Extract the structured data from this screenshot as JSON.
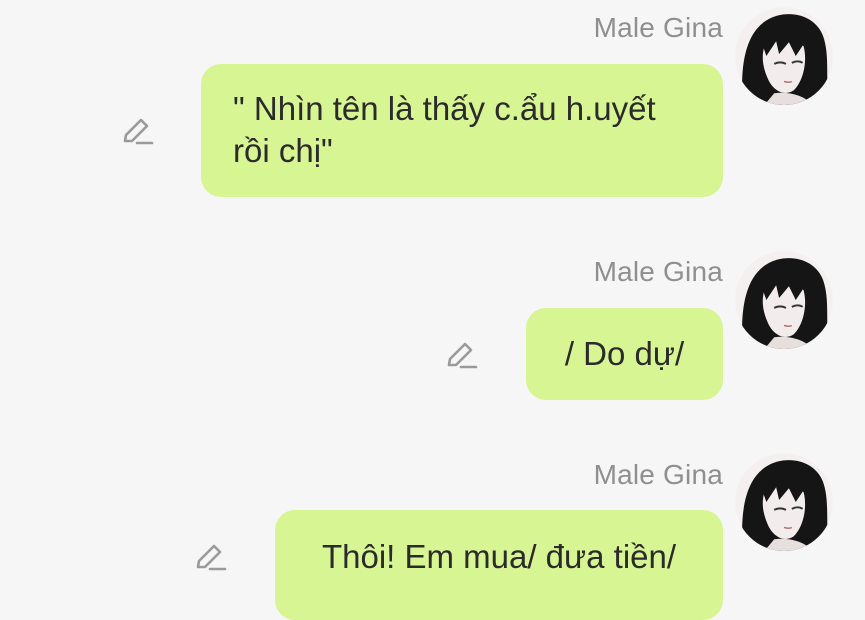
{
  "colors": {
    "background": "#f6f6f6",
    "bubble": "#d8f594",
    "sender_name": "#8f8f8f",
    "message_text": "#2b2b2b",
    "edit_icon": "#9a9a9a"
  },
  "messages": [
    {
      "sender": "Male Gina",
      "text": "\" Nhìn tên là thấy c.ẩu h.uyết rồi chị\"",
      "action_icon": "pencil-edit-icon"
    },
    {
      "sender": "Male Gina",
      "text": "/ Do dự/",
      "action_icon": "pencil-edit-icon"
    },
    {
      "sender": "Male Gina",
      "text": "Thôi! Em mua/ đưa tiền/",
      "action_icon": "pencil-edit-icon"
    }
  ]
}
